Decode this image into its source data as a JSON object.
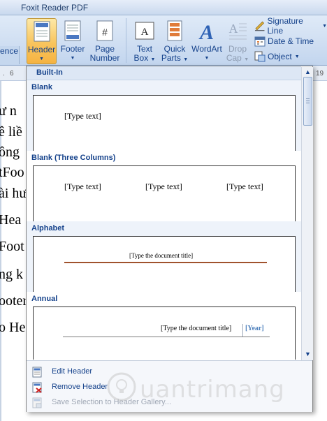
{
  "window": {
    "title": "Foxit Reader PDF"
  },
  "ribbon": {
    "prev_label": "ence",
    "header_label": "Header",
    "footer_label": "Footer",
    "page_number_label_1": "Page",
    "page_number_label_2": "Number",
    "textbox_label_1": "Text",
    "textbox_label_2": "Box",
    "quickparts_label_1": "Quick",
    "quickparts_label_2": "Parts",
    "wordart_label": "WordArt",
    "dropcap_label_1": "Drop",
    "dropcap_label_2": "Cap",
    "signature_line": "Signature Line",
    "date_time": "Date & Time",
    "object": "Object"
  },
  "document": {
    "ruler_marks": [
      ".",
      "6",
      "19"
    ],
    "lines": [
      "ư n",
      "ê liề",
      "ông",
      "tFoo",
      "ài hư",
      "Hea",
      "Foot",
      "ng k",
      "ooter",
      "o He"
    ]
  },
  "gallery": {
    "section_title": "Built-In",
    "items": [
      {
        "name": "Blank",
        "placeholders": [
          "[Type text]"
        ]
      },
      {
        "name": "Blank (Three Columns)",
        "placeholders": [
          "[Type text]",
          "[Type text]",
          "[Type text]"
        ]
      },
      {
        "name": "Alphabet",
        "placeholders": [
          "[Type the document title]"
        ]
      },
      {
        "name": "Annual",
        "placeholders": [
          "[Type the document title]",
          "[Year]"
        ]
      }
    ],
    "menu": {
      "edit_header": "Edit Header",
      "remove_header": "Remove Header",
      "save_selection": "Save Selection to Header Gallery..."
    }
  },
  "colors": {
    "accent": "#15428b",
    "selected": "#f8c45d",
    "alphabet_rule": "#a0522d",
    "year": "#4f81bd"
  },
  "watermark": "uantrimang"
}
